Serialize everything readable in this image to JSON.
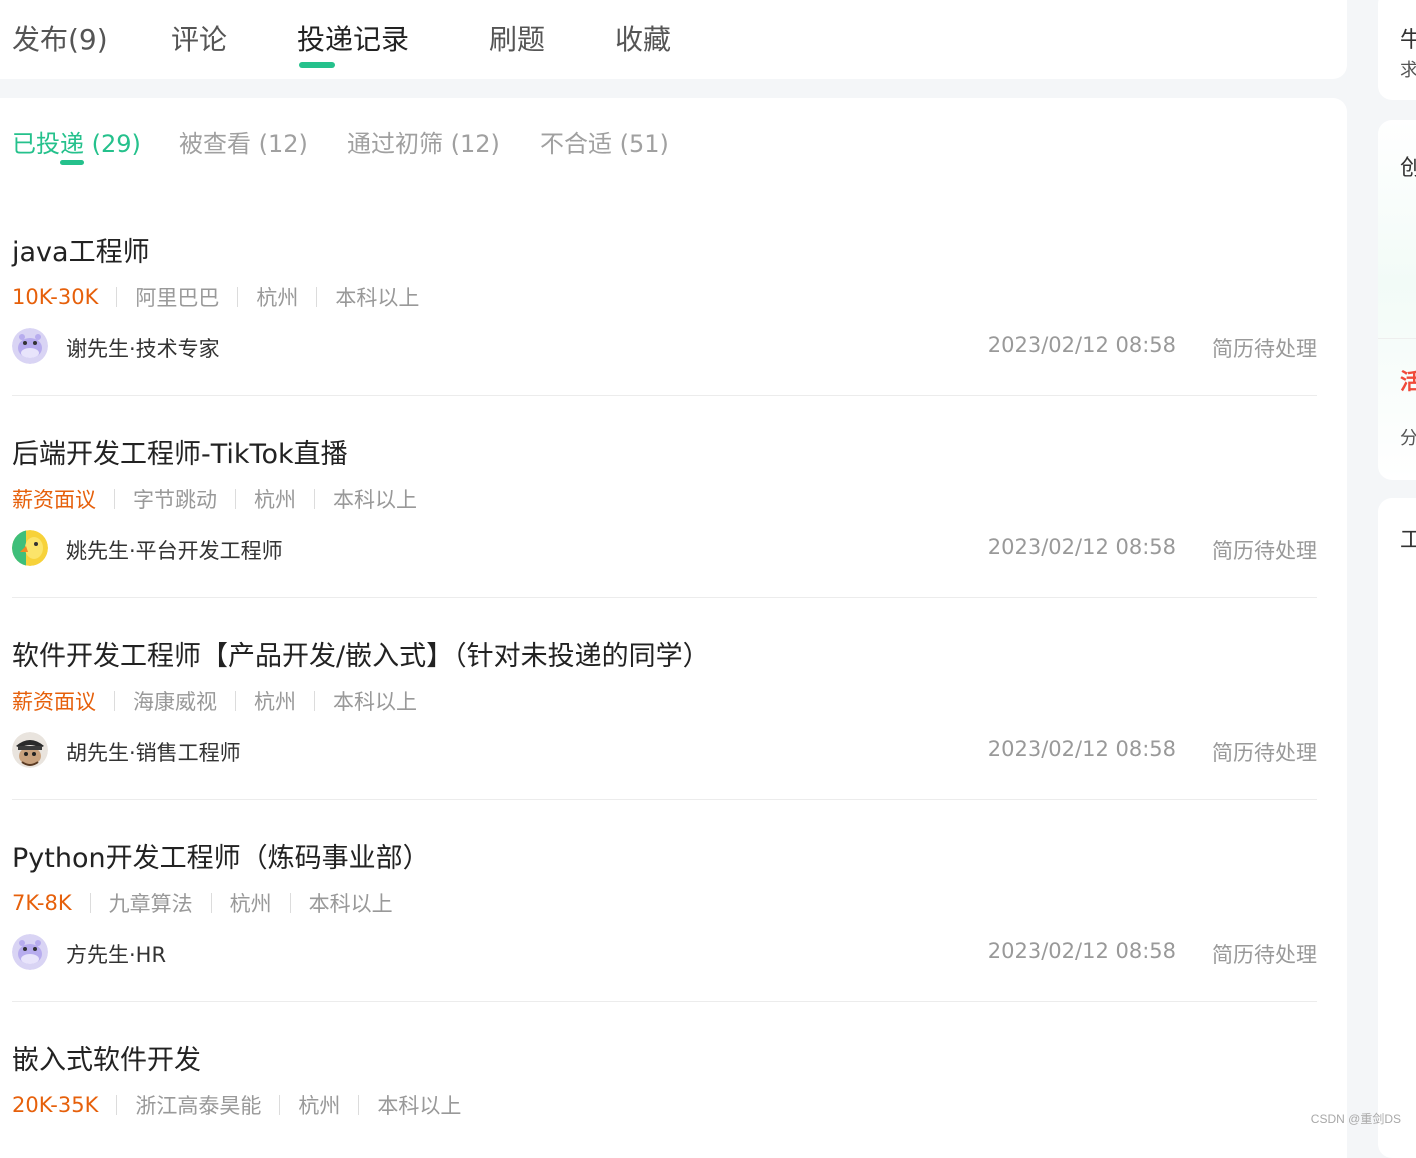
{
  "top_tabs": [
    {
      "label": "发布(9)"
    },
    {
      "label": "评论"
    },
    {
      "label": "投递记录"
    },
    {
      "label": "刷题"
    },
    {
      "label": "收藏"
    }
  ],
  "sub_tabs": [
    {
      "label": "已投递 (29)"
    },
    {
      "label": "被查看 (12)"
    },
    {
      "label": "通过初筛 (12)"
    },
    {
      "label": "不合适 (51)"
    }
  ],
  "jobs": [
    {
      "title": "java工程师",
      "salary": "10K-30K",
      "company": "阿里巴巴",
      "city": "杭州",
      "education": "本科以上",
      "recruiter": "谢先生·技术专家",
      "time": "2023/02/12 08:58",
      "status": "简历待处理",
      "avatar_icon": "hippo-avatar"
    },
    {
      "title": "后端开发工程师-TikTok直播",
      "salary": "薪资面议",
      "company": "字节跳动",
      "city": "杭州",
      "education": "本科以上",
      "recruiter": "姚先生·平台开发工程师",
      "time": "2023/02/12 08:58",
      "status": "简历待处理",
      "avatar_icon": "parrot-avatar"
    },
    {
      "title": "软件开发工程师【产品开发/嵌入式】（针对未投递的同学）",
      "salary": "薪资面议",
      "company": "海康威视",
      "city": "杭州",
      "education": "本科以上",
      "recruiter": "胡先生·销售工程师",
      "time": "2023/02/12 08:58",
      "status": "简历待处理",
      "avatar_icon": "pirate-avatar"
    },
    {
      "title": "Python开发工程师（炼码事业部）",
      "salary": "7K-8K",
      "company": "九章算法",
      "city": "杭州",
      "education": "本科以上",
      "recruiter": "方先生·HR",
      "time": "2023/02/12 08:58",
      "status": "简历待处理",
      "avatar_icon": "hippo-avatar"
    },
    {
      "title": "嵌入式软件开发",
      "salary": "20K-35K",
      "company": "浙江高泰昊能",
      "city": "杭州",
      "education": "本科以上"
    }
  ],
  "side": {
    "card1_title": "牛",
    "card1_sub": "求",
    "card2_text": "创",
    "card3_title": "活",
    "card3_sub": "分",
    "card4_text": "工"
  },
  "colors": {
    "accent": "#25c18c",
    "salary": "#e6600b",
    "muted": "#999999"
  },
  "watermark": "CSDN @重剑DS"
}
